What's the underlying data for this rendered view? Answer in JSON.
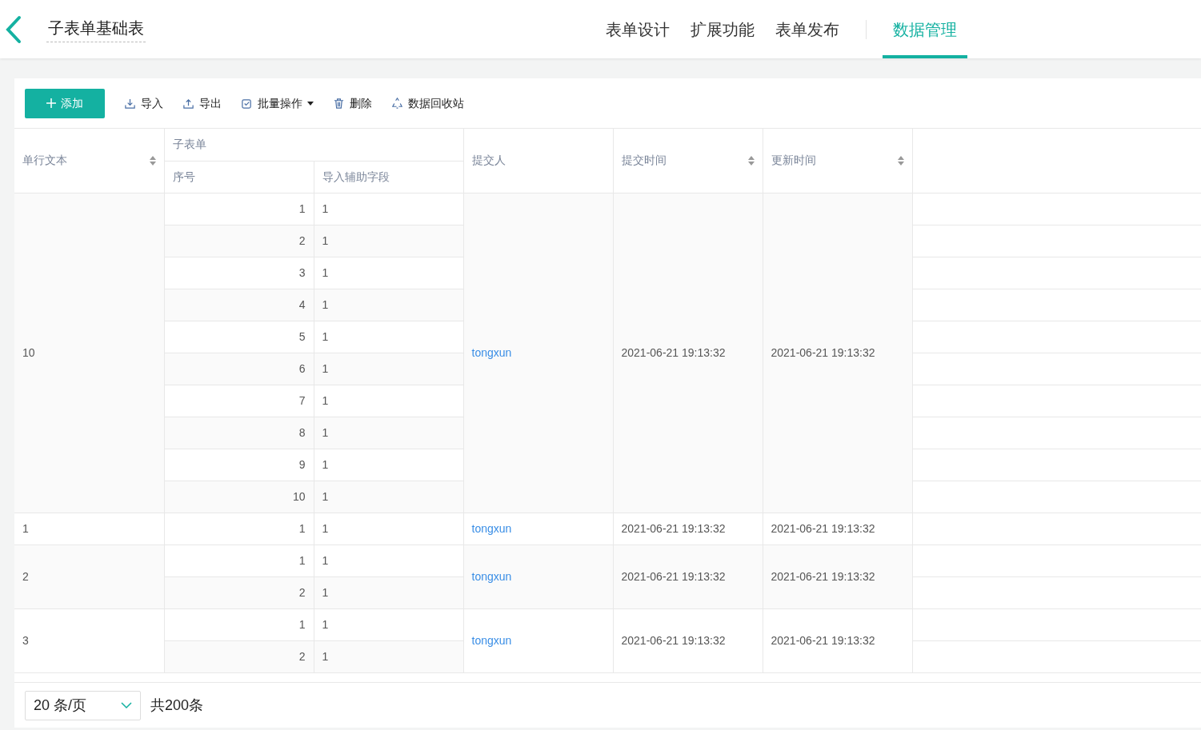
{
  "header": {
    "title": "子表单基础表",
    "tabs": [
      {
        "label": "表单设计",
        "selected": false
      },
      {
        "label": "扩展功能",
        "selected": false
      },
      {
        "label": "表单发布",
        "selected": false
      },
      {
        "label": "数据管理",
        "selected": true
      }
    ]
  },
  "toolbar": {
    "primary": "添加",
    "actions": [
      {
        "kind": "import",
        "label": "导入"
      },
      {
        "kind": "export",
        "label": "导出"
      },
      {
        "kind": "batch",
        "label": "批量操作"
      },
      {
        "kind": "delete",
        "label": "删除"
      },
      {
        "kind": "recycle",
        "label": "数据回收站"
      }
    ]
  },
  "table": {
    "columns": {
      "text": "单行文本",
      "subform": "子表单",
      "seq": "序号",
      "aux": "导入辅助字段",
      "submitter": "提交人",
      "submitted": "提交时间",
      "updated": "更新时间"
    },
    "rows": [
      {
        "text": "10",
        "children": [
          {
            "seq": "1",
            "aux": "1"
          },
          {
            "seq": "2",
            "aux": "1"
          },
          {
            "seq": "3",
            "aux": "1"
          },
          {
            "seq": "4",
            "aux": "1"
          },
          {
            "seq": "5",
            "aux": "1"
          },
          {
            "seq": "6",
            "aux": "1"
          },
          {
            "seq": "7",
            "aux": "1"
          },
          {
            "seq": "8",
            "aux": "1"
          },
          {
            "seq": "9",
            "aux": "1"
          },
          {
            "seq": "10",
            "aux": "1"
          }
        ],
        "submitter": "tongxun",
        "submitted": "2021-06-21 19:13:32",
        "updated": "2021-06-21 19:13:32"
      },
      {
        "text": "1",
        "children": [
          {
            "seq": "1",
            "aux": "1"
          }
        ],
        "submitter": "tongxun",
        "submitted": "2021-06-21 19:13:32",
        "updated": "2021-06-21 19:13:32"
      },
      {
        "text": "2",
        "children": [
          {
            "seq": "1",
            "aux": "1"
          },
          {
            "seq": "2",
            "aux": "1"
          }
        ],
        "submitter": "tongxun",
        "submitted": "2021-06-21 19:13:32",
        "updated": "2021-06-21 19:13:32"
      },
      {
        "text": "3",
        "children": [
          {
            "seq": "1",
            "aux": "1"
          },
          {
            "seq": "2",
            "aux": "1"
          }
        ],
        "submitter": "tongxun",
        "submitted": "2021-06-21 19:13:32",
        "updated": "2021-06-21 19:13:32"
      }
    ]
  },
  "pagination": {
    "page_size": "20 条/页",
    "total": "共200条"
  }
}
